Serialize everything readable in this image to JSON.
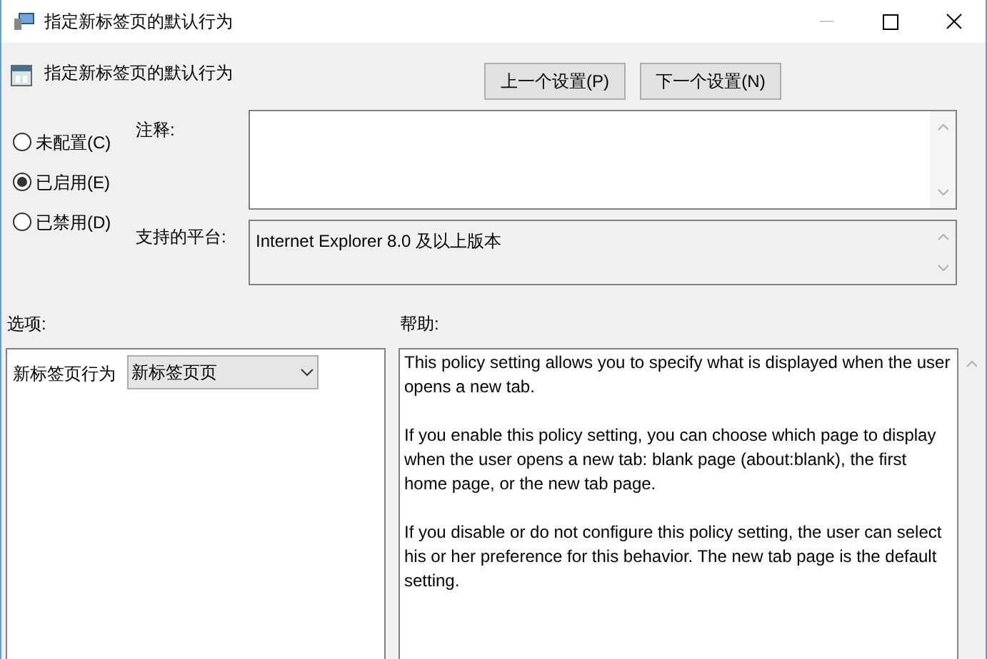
{
  "window": {
    "title": "指定新标签页的默认行为"
  },
  "header": {
    "title": "指定新标签页的默认行为",
    "buttons": [
      "上一个设置(P)",
      "下一个设置(N)"
    ]
  },
  "states": [
    {
      "label": "未配置(C)",
      "selected": false
    },
    {
      "label": "已启用(E)",
      "selected": true
    },
    {
      "label": "已禁用(D)",
      "selected": false
    }
  ],
  "comment": {
    "label": "注释:"
  },
  "platform": {
    "label": "支持的平台:",
    "value": "Internet Explorer 8.0 及以上版本"
  },
  "options": {
    "label": "选项:",
    "setting_label": "新标签页行为",
    "dropdown_value": "新标签页页"
  },
  "help": {
    "label": "帮助:",
    "paragraphs": [
      "This policy setting allows you to specify what is displayed when the user opens a new tab.",
      "If you enable this policy setting, you can choose which page to display when the user opens a new tab: blank page (about:blank), the first home page, or the new tab page.",
      "If you disable or do not configure this policy setting, the user can select his or her preference for this behavior. The new tab page is the default setting."
    ]
  }
}
